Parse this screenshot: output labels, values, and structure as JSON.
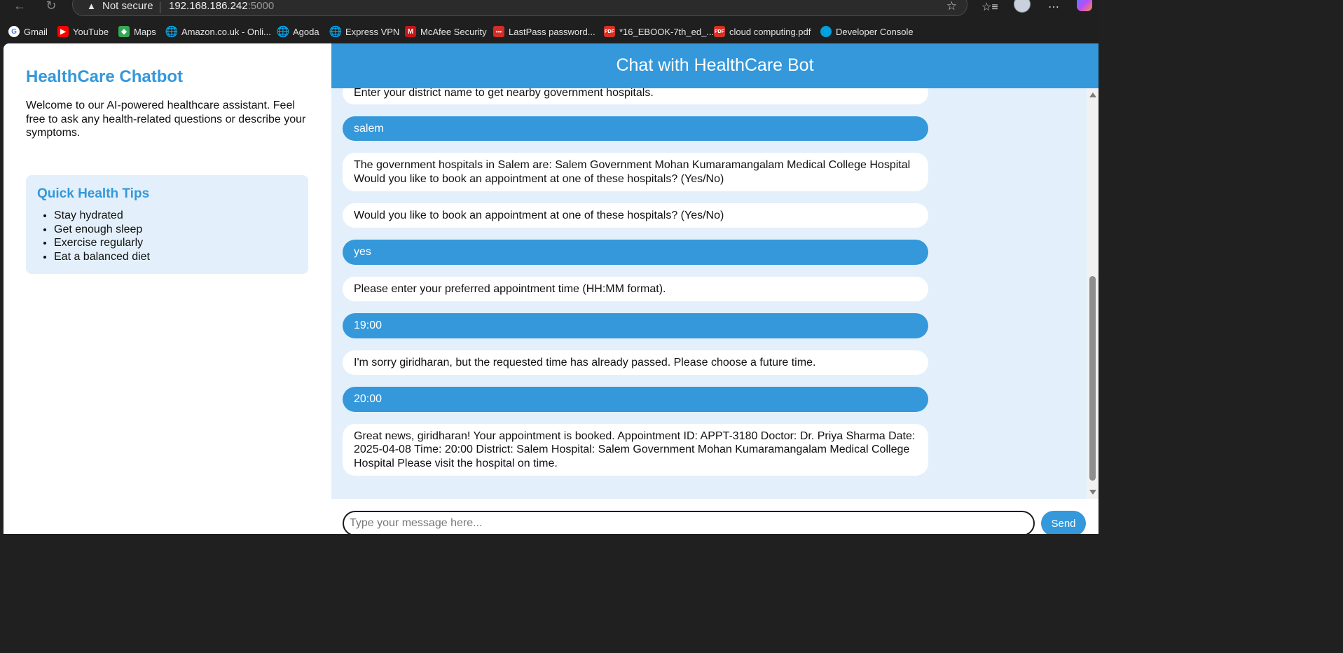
{
  "browser": {
    "security_label": "Not secure",
    "host": "192.168.186.242",
    "port": ":5000",
    "bookmarks": [
      {
        "label": "Gmail",
        "icon": "google-icon",
        "color": "#4285f4"
      },
      {
        "label": "YouTube",
        "icon": "youtube-icon",
        "color": "#ff0000"
      },
      {
        "label": "Maps",
        "icon": "maps-icon",
        "color": "#34a853"
      },
      {
        "label": "Amazon.co.uk - Onli...",
        "icon": "globe-icon",
        "color": "#cfcfcf"
      },
      {
        "label": "Agoda",
        "icon": "globe-icon",
        "color": "#cfcfcf"
      },
      {
        "label": "Express VPN",
        "icon": "globe-icon",
        "color": "#cfcfcf"
      },
      {
        "label": "McAfee Security",
        "icon": "mcafee-icon",
        "color": "#c01818"
      },
      {
        "label": "LastPass password...",
        "icon": "lastpass-icon",
        "color": "#d32d27"
      },
      {
        "label": "*16_EBOOK-7th_ed_...",
        "icon": "pdf-icon",
        "color": "#d93025"
      },
      {
        "label": "cloud computing.pdf",
        "icon": "pdf-icon",
        "color": "#d93025"
      },
      {
        "label": "Developer Console",
        "icon": "salesforce-icon",
        "color": "#00a1e0"
      }
    ]
  },
  "sidebar": {
    "title": "HealthCare Chatbot",
    "welcome": "Welcome to our AI-powered healthcare assistant. Feel free to ask any health-related questions or describe your symptoms.",
    "tips_title": "Quick Health Tips",
    "tips": [
      "Stay hydrated",
      "Get enough sleep",
      "Exercise regularly",
      "Eat a balanced diet"
    ]
  },
  "chat": {
    "header": "Chat with HealthCare Bot",
    "messages": [
      {
        "role": "bot",
        "text": "Enter your district name to get nearby government hospitals."
      },
      {
        "role": "user",
        "text": "salem"
      },
      {
        "role": "bot",
        "text": "The government hospitals in Salem are: Salem Government Mohan Kumaramangalam Medical College Hospital Would you like to book an appointment at one of these hospitals? (Yes/No)"
      },
      {
        "role": "bot",
        "text": "Would you like to book an appointment at one of these hospitals? (Yes/No)"
      },
      {
        "role": "user",
        "text": "yes"
      },
      {
        "role": "bot",
        "text": "Please enter your preferred appointment time (HH:MM format)."
      },
      {
        "role": "user",
        "text": "19:00"
      },
      {
        "role": "bot",
        "text": "I'm sorry giridharan, but the requested time has already passed. Please choose a future time."
      },
      {
        "role": "user",
        "text": "20:00"
      },
      {
        "role": "bot",
        "text": "Great news, giridharan! Your appointment is booked. Appointment ID: APPT-3180 Doctor: Dr. Priya Sharma Date: 2025-04-08 Time: 20:00 District: Salem Hospital: Salem Government Mohan Kumaramangalam Medical College Hospital Please visit the hospital on time."
      }
    ],
    "input_placeholder": "Type your message here...",
    "input_value": "",
    "send_label": "Send"
  },
  "colors": {
    "accent": "#3498db",
    "chat_bg": "#e3f0fb",
    "bot_bubble": "#ffffff"
  }
}
